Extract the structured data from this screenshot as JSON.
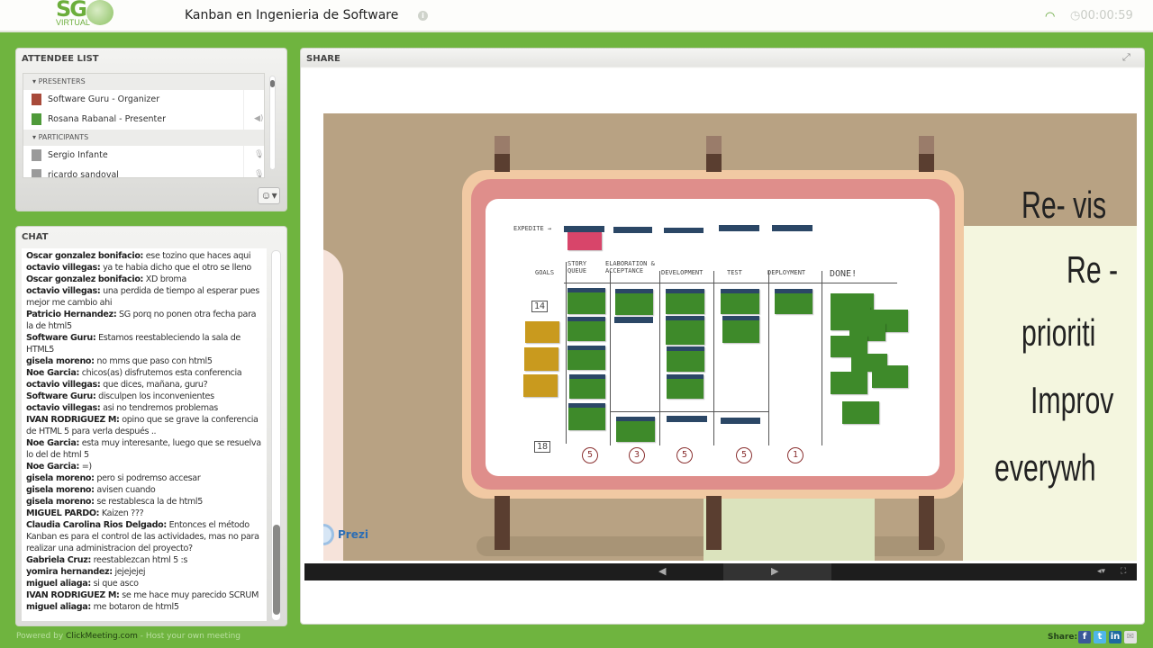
{
  "header": {
    "logo_text": "SG",
    "logo_sub": "VIRTUAL",
    "title": "Kanban en Ingenieria de Software",
    "timer": "00:00:59"
  },
  "attendees": {
    "title": "ATTENDEE LIST",
    "groups": [
      {
        "label": "PRESENTERS",
        "people": [
          {
            "name": "Software Guru - Organizer",
            "color": "#a84a3a"
          },
          {
            "name": "Rosana Rabanal - Presenter",
            "color": "#4f9a3a"
          }
        ]
      },
      {
        "label": "PARTICIPANTS",
        "people": [
          {
            "name": "Sergio Infante",
            "color": "#9a9a9a"
          },
          {
            "name": "ricardo sandoval",
            "color": "#9a9a9a"
          }
        ]
      }
    ]
  },
  "chat": {
    "title": "CHAT",
    "messages": [
      {
        "name": "Oscar gonzalez bonifacio:",
        "text": "ese tozino que haces aqui"
      },
      {
        "name": "octavio villegas:",
        "text": "ya te habia dicho que el otro se lleno"
      },
      {
        "name": "Oscar gonzalez bonifacio:",
        "text": "XD broma"
      },
      {
        "name": "octavio villegas:",
        "text": "una perdida de tiempo al esperar pues mejor me cambio ahi"
      },
      {
        "name": "Patricio Hernandez:",
        "text": "SG porq no ponen otra fecha para la de html5"
      },
      {
        "name": "Software Guru:",
        "text": "Estamos reestableciendo la sala de HTML5"
      },
      {
        "name": "gisela moreno:",
        "text": "no mms que paso con html5"
      },
      {
        "name": "Noe Garcia:",
        "text": "chicos(as) disfrutemos esta conferencia"
      },
      {
        "name": "octavio villegas:",
        "text": "que dices, mañana, guru?"
      },
      {
        "name": "Software Guru:",
        "text": "disculpen los inconvenientes"
      },
      {
        "name": "octavio villegas:",
        "text": "asi no tendremos problemas"
      },
      {
        "name": "IVAN RODRIGUEZ M:",
        "text": "opino que se grave la conferencia de HTML 5 para verla después .."
      },
      {
        "name": "Noe Garcia:",
        "text": "esta muy interesante, luego que se resuelva lo del de html 5"
      },
      {
        "name": "Noe Garcia:",
        "text": "=)"
      },
      {
        "name": "gisela moreno:",
        "text": "pero si podremso accesar"
      },
      {
        "name": "gisela moreno:",
        "text": "avisen cuando"
      },
      {
        "name": "gisela moreno:",
        "text": "se restablesca la de html5"
      },
      {
        "name": "MIGUEL PARDO:",
        "text": "Kaizen ???"
      },
      {
        "name": "Claudia Carolina Rios Delgado:",
        "text": "Entonces el método Kanban  es para el control de las actividades, mas no para realizar una administracion del proyecto?"
      },
      {
        "name": "Gabriela Cruz:",
        "text": "reestablezcan html 5 :s"
      },
      {
        "name": "yomira hernandez:",
        "text": "jejejejej"
      },
      {
        "name": "miguel aliaga:",
        "text": "si que asco"
      },
      {
        "name": "IVAN RODRIGUEZ M:",
        "text": "se me hace muy parecido SCRUM"
      },
      {
        "name": "miguel aliaga:",
        "text": "me botaron de html5"
      }
    ]
  },
  "share": {
    "title": "SHARE",
    "slide": {
      "board": {
        "expedite": "EXPEDITE →",
        "columns": [
          "GOALS",
          "STORY QUEUE",
          "ELABORATION & ACCEPTANCE",
          "DEVELOPMENT",
          "TEST",
          "DEPLOYMENT",
          "DONE!"
        ],
        "limit_top": "14",
        "limit_bottom": "18",
        "wip_limits": [
          "5",
          "3",
          "5",
          "5",
          "1"
        ]
      },
      "text_lines": [
        "Re- vis",
        "Re -",
        "prioriti",
        "Improv",
        "everywh"
      ],
      "prezi_label": "Prezi"
    }
  },
  "footer": {
    "powered_prefix": "Powered by ",
    "powered_link": "ClickMeeting.com",
    "powered_suffix": " - Host your own meeting",
    "share_label": "Share:"
  },
  "colors": {
    "brand_green": "#6fb43f",
    "card_green": "#3e8a2a",
    "strip_blue": "#2b4766",
    "goal_yellow": "#c99a1e",
    "expedite_pink": "#d8456a"
  }
}
